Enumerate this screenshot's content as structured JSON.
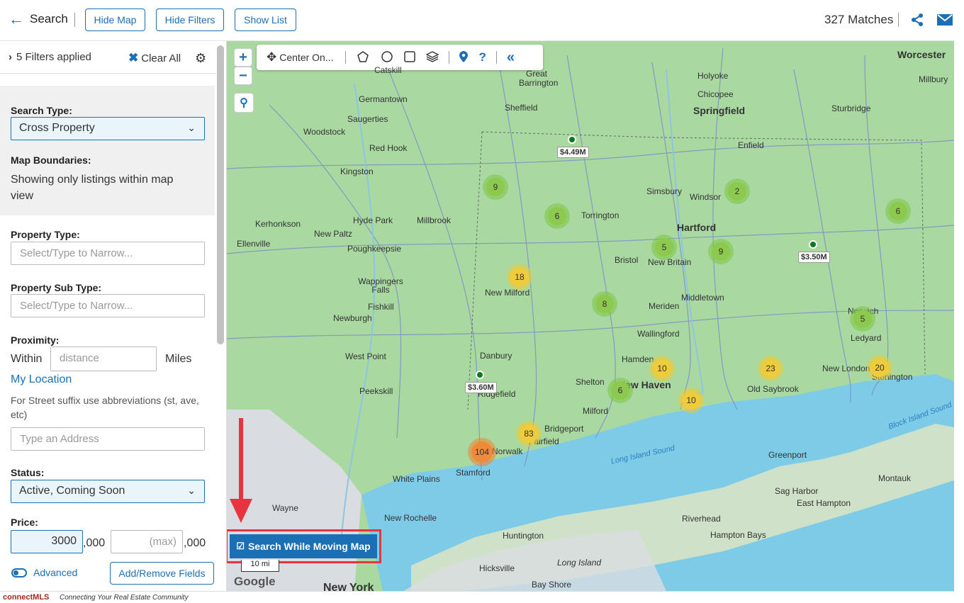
{
  "header": {
    "back_label": "Search",
    "hide_map": "Hide Map",
    "hide_filters": "Hide Filters",
    "show_list": "Show List",
    "matches": "327 Matches"
  },
  "sidebar": {
    "filters_applied": "5 Filters applied",
    "clear_all": "Clear All",
    "search_type_label": "Search Type:",
    "search_type_value": "Cross Property",
    "map_boundaries_label": "Map Boundaries:",
    "map_boundaries_text": "Showing only listings within map view",
    "property_type_label": "Property Type:",
    "property_type_placeholder": "Select/Type to Narrow...",
    "property_sub_type_label": "Property Sub Type:",
    "property_sub_type_placeholder": "Select/Type to Narrow...",
    "proximity_label": "Proximity:",
    "within": "Within",
    "distance_placeholder": "distance",
    "miles": "Miles",
    "my_location": "My Location",
    "street_hint": "For Street suffix use abbreviations (st, ave, etc)",
    "address_placeholder": "Type an Address",
    "status_label": "Status:",
    "status_value": "Active, Coming Soon",
    "price_label": "Price:",
    "price_min": "3000",
    "price_max_placeholder": "(max)",
    "thousands": ",000",
    "advanced": "Advanced",
    "add_remove": "Add/Remove Fields"
  },
  "map": {
    "center_on": "Center On...",
    "search_while_moving": "Search While Moving Map",
    "scale": "10 mi",
    "google": "Google",
    "clusters": [
      {
        "count": "9",
        "tone": "green"
      },
      {
        "count": "6",
        "tone": "green"
      },
      {
        "count": "18",
        "tone": "yellow"
      },
      {
        "count": "8",
        "tone": "green"
      },
      {
        "count": "5",
        "tone": "green"
      },
      {
        "count": "9",
        "tone": "green"
      },
      {
        "count": "2",
        "tone": "green"
      },
      {
        "count": "6",
        "tone": "green"
      },
      {
        "count": "5",
        "tone": "green"
      },
      {
        "count": "10",
        "tone": "yellow"
      },
      {
        "count": "23",
        "tone": "yellow"
      },
      {
        "count": "20",
        "tone": "yellow"
      },
      {
        "count": "6",
        "tone": "green"
      },
      {
        "count": "10",
        "tone": "yellow"
      },
      {
        "count": "83",
        "tone": "yellow"
      },
      {
        "count": "104",
        "tone": "orange"
      }
    ],
    "pins": [
      {
        "price": "$4.49M"
      },
      {
        "price": "$3.50M"
      },
      {
        "price": "$3.60M"
      }
    ],
    "cities": [
      "Catskill",
      "Great Barrington",
      "Holyoke",
      "Worcester",
      "Millbury",
      "Chicopee",
      "Germantown",
      "Sheffield",
      "Springfield",
      "Sturbridge",
      "Woodstock",
      "Saugerties",
      "Enfield",
      "Red Hook",
      "Kingston",
      "Simsbury",
      "Windsor",
      "Torrington",
      "Kerhonkson",
      "Hyde Park",
      "Millbrook",
      "Hartford",
      "New Paltz",
      "Ellenville",
      "Poughkeepsie",
      "Bristol",
      "New Britain",
      "Wappingers Falls",
      "New Milford",
      "Middletown",
      "Fishkill",
      "Newburgh",
      "Meriden",
      "Norwich",
      "Wallingford",
      "Ledyard",
      "Danbury",
      "West Point",
      "Hamden",
      "New London",
      "Stonington",
      "Shelton",
      "New Haven",
      "Old Saybrook",
      "Ridgefield",
      "Peekskill",
      "Milford",
      "Bridgeport",
      "Fairfield",
      "Norwalk",
      "Stamford",
      "White Plains",
      "Greenport",
      "Montauk",
      "Sag Harbor",
      "East Hampton",
      "Wayne",
      "New Rochelle",
      "Riverhead",
      "Hampton Bays",
      "Huntington",
      "Long Island",
      "Hicksville",
      "Bay Shore",
      "New York"
    ],
    "water": [
      "Long Island Sound",
      "Block Island Sound"
    ]
  },
  "footer": {
    "brand": "connectMLS",
    "tagline": "Connecting Your Real Estate Community"
  },
  "colors": {
    "accent": "#1b6fb5",
    "highlight": "#e8343f",
    "land": "#a9d9a1",
    "water": "#7ecbe8"
  }
}
